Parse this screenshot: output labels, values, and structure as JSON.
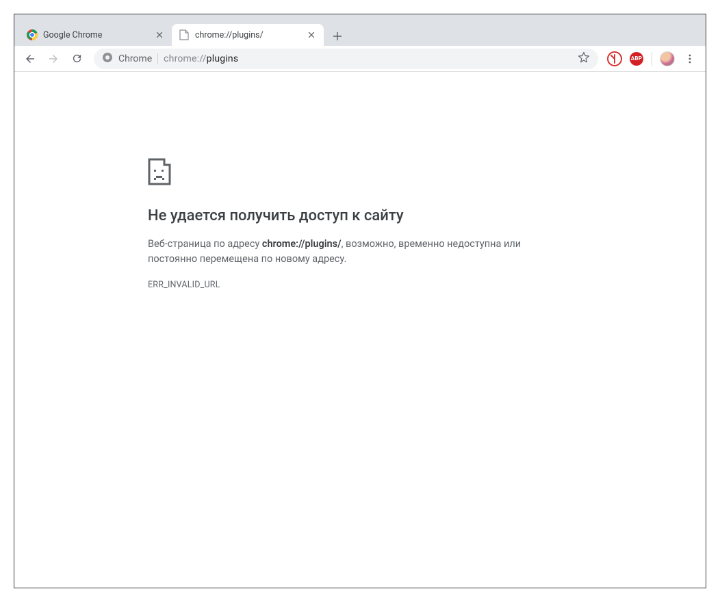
{
  "tabs": [
    {
      "title": "Google Chrome",
      "active": false
    },
    {
      "title": "chrome://plugins/",
      "active": true
    }
  ],
  "omnibox": {
    "scheme_label": "Chrome",
    "url_muted_prefix": "chrome://",
    "url_dark_suffix": "plugins"
  },
  "extensions": {
    "abp_label": "ABP"
  },
  "error_page": {
    "heading": "Не удается получить доступ к сайту",
    "desc_prefix": "Веб-страница по адресу ",
    "desc_url": "chrome://plugins/",
    "desc_suffix": ", возможно, временно недоступна или постоянно перемещена по новому адресу.",
    "error_code": "ERR_INVALID_URL"
  }
}
